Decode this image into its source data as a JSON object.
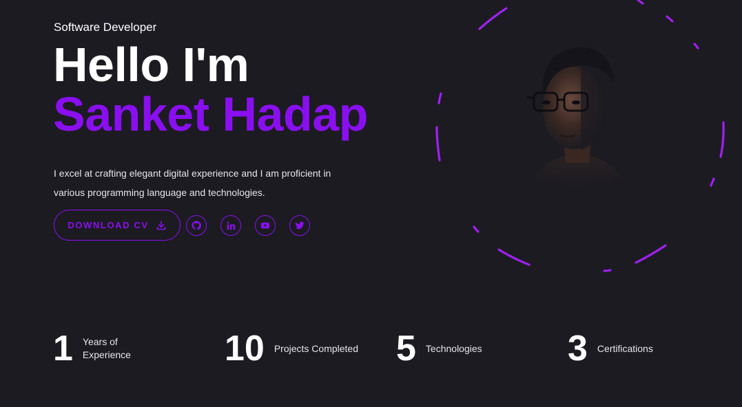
{
  "hero": {
    "subtitle": "Software Developer",
    "greeting": "Hello I'm",
    "name": "Sanket Hadap",
    "description": "I excel at crafting elegant digital experience and I am proficient in various programming language and technologies.",
    "cv_button_label": "DOWNLOAD CV",
    "cv_button_icon": "download-icon",
    "socials": [
      {
        "name": "github",
        "icon": "github-icon"
      },
      {
        "name": "linkedin",
        "icon": "linkedin-icon"
      },
      {
        "name": "youtube",
        "icon": "youtube-icon"
      },
      {
        "name": "twitter",
        "icon": "twitter-icon"
      }
    ]
  },
  "stats": [
    {
      "number": "1",
      "label": "Years of Experience"
    },
    {
      "number": "10",
      "label": "Projects Completed"
    },
    {
      "number": "5",
      "label": "Technologies"
    },
    {
      "number": "3",
      "label": "Certifications"
    }
  ],
  "colors": {
    "background": "#1c1b22",
    "accent": "#8a0ff0",
    "ring": "#a020f0",
    "text": "#ffffff",
    "muted_text": "#e6e6ea"
  }
}
